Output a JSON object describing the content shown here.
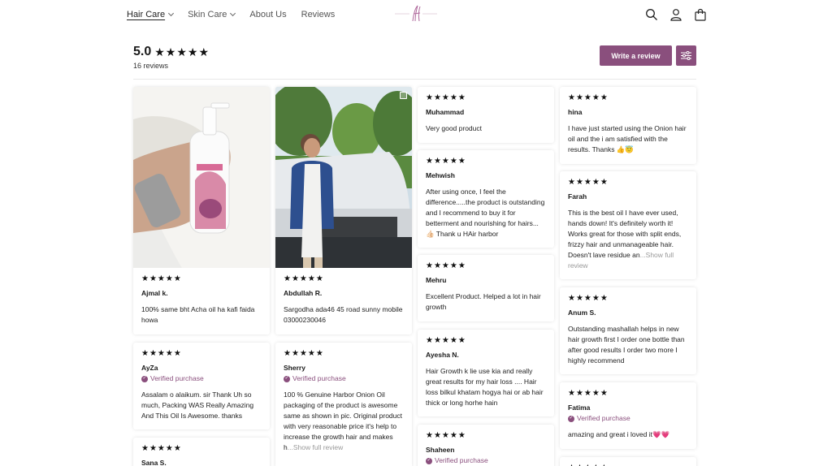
{
  "nav": [
    {
      "label": "Hair Care",
      "dropdown": true,
      "active": true
    },
    {
      "label": "Skin Care",
      "dropdown": true,
      "active": false
    },
    {
      "label": "About Us",
      "dropdown": false,
      "active": false
    },
    {
      "label": "Reviews",
      "dropdown": false,
      "active": false
    }
  ],
  "header_icons": [
    "search-icon",
    "account-icon",
    "cart-icon"
  ],
  "summary": {
    "score": "5.0",
    "stars": "★★★★★",
    "count": "16 reviews"
  },
  "write_review_label": "Write a review",
  "brand_color": "#8a4f7d",
  "stars": "★★★★★",
  "verified_label": "Verified purchase",
  "show_more": "...Show",
  "full_review": "full review",
  "reviews": {
    "ajmal": {
      "name": "Ajmal k.",
      "text": "100% same bht Acha oil ha kafi faida howa"
    },
    "abdullah": {
      "name": "Abdullah R.",
      "text": "Sargodha ada46 45 road sunny mobile 03000230046"
    },
    "ayza": {
      "name": "AyZa",
      "text": "Assalam o alaikum. sir Thank Uh so much, Packing WAS Really Amazing And This Oil Is Awesome. thanks"
    },
    "sherry": {
      "name": "Sherry",
      "text": "100 % Genuine Harbor Onion Oil packaging of the product is awesome same as shown in pic. Original product with very reasonable price it's help to increase the growth hair and makes h"
    },
    "sana": {
      "name": "Sana S."
    },
    "muhammad": {
      "name": "Muhammad",
      "text": "Very good product"
    },
    "mehwish": {
      "name": "Mehwish",
      "text": "After using once, I feel the difference.....the product is outstanding and I recommend to buy it for betterment and nourishing for hairs...👍🏻 Thank u HAir harbor"
    },
    "mehru": {
      "name": "Mehru",
      "text": "Excellent Product. Helped a lot in hair growth"
    },
    "ayesha": {
      "name": "Ayesha N.",
      "text": "Hair Growth k lie use kia and really great results for my hair loss .... Hair loss bilkul khatam hogya hai or ab hair thick or long horhe hain"
    },
    "shaheen": {
      "name": "Shaheen"
    },
    "hina": {
      "name": "hina",
      "text": "I have just started using the Onion hair oil and the i am satisfied with the results. Thanks 👍😇"
    },
    "farah": {
      "name": "Farah",
      "text": "This is the best oil I have ever used, hands down! It's definitely worth it! Works great for those with split ends, frizzy hair and unmanageable hair. Doesn't lave residue an"
    },
    "anum": {
      "name": "Anum S.",
      "text": "Outstanding mashallah helps in new hair growth first I order one bottle than after good results I order two more I highly recommend"
    },
    "fatima": {
      "name": "Fatima",
      "text": "amazing and great i loved it💗💗"
    }
  }
}
